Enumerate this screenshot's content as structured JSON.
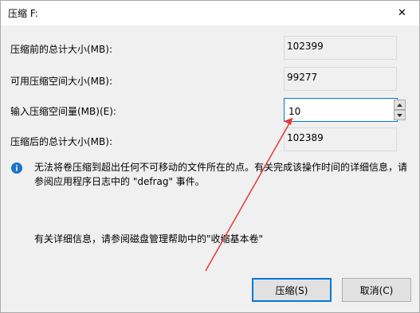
{
  "window": {
    "title": "压缩 F:",
    "close_glyph": "✕"
  },
  "fields": {
    "total_before": {
      "label": "压缩前的总计大小(MB):",
      "value": "102399"
    },
    "available": {
      "label": "可用压缩空间大小(MB):",
      "value": "99277"
    },
    "shrink_amount": {
      "label": "输入压缩空间量(MB)(E):",
      "value": "10"
    },
    "total_after": {
      "label": "压缩后的总计大小(MB):",
      "value": "102389"
    }
  },
  "info": {
    "icon": "info-icon",
    "text": "无法将卷压缩到超出任何不可移动的文件所在的点。有关完成该操作时间的详细信息，请参阅应用程序日志中的 \"defrag\" 事件。"
  },
  "help": {
    "text": "有关详细信息，请参阅磁盘管理帮助中的\"收缩基本卷\""
  },
  "buttons": {
    "shrink": "压缩(S)",
    "cancel": "取消(C)"
  },
  "colors": {
    "accent": "#0078d7",
    "annotation_arrow": "#e53935",
    "info_icon": "#1e73c8"
  }
}
